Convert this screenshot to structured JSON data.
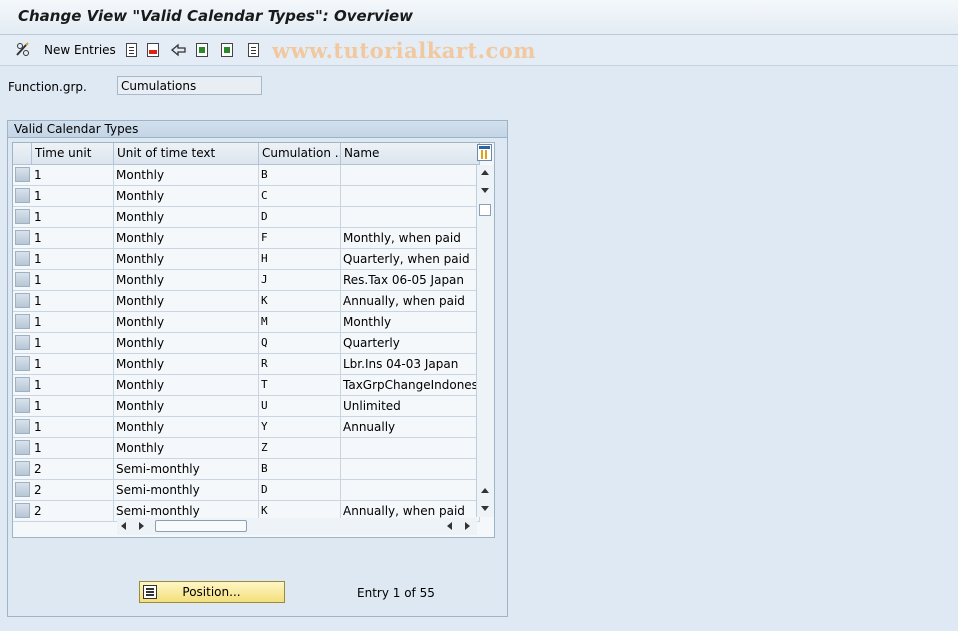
{
  "window": {
    "title": "Change View \"Valid Calendar Types\": Overview"
  },
  "toolbar": {
    "new_entries_label": "New Entries",
    "icons": [
      "pencil-glasses-icon",
      "copy-icon",
      "delete-icon",
      "undo-icon",
      "select-all-icon",
      "select-block-icon",
      "deselect-all-icon"
    ]
  },
  "watermark": "www.tutorialkart.com",
  "filter": {
    "label": "Function.grp.",
    "value": "Cumulations"
  },
  "group": {
    "title": "Valid Calendar Types",
    "columns": [
      "Time unit",
      "Unit of time text",
      "Cumulation ...",
      "Name"
    ],
    "rows": [
      [
        "1",
        "Monthly",
        "B",
        ""
      ],
      [
        "1",
        "Monthly",
        "C",
        ""
      ],
      [
        "1",
        "Monthly",
        "D",
        ""
      ],
      [
        "1",
        "Monthly",
        "F",
        "Monthly, when paid"
      ],
      [
        "1",
        "Monthly",
        "H",
        "Quarterly, when paid"
      ],
      [
        "1",
        "Monthly",
        "J",
        "Res.Tax 06-05  Japan"
      ],
      [
        "1",
        "Monthly",
        "K",
        "Annually, when paid"
      ],
      [
        "1",
        "Monthly",
        "M",
        "Monthly"
      ],
      [
        "1",
        "Monthly",
        "Q",
        "Quarterly"
      ],
      [
        "1",
        "Monthly",
        "R",
        "Lbr.Ins 04-03  Japan"
      ],
      [
        "1",
        "Monthly",
        "T",
        "TaxGrpChangeIndones."
      ],
      [
        "1",
        "Monthly",
        "U",
        "Unlimited"
      ],
      [
        "1",
        "Monthly",
        "Y",
        "Annually"
      ],
      [
        "1",
        "Monthly",
        "Z",
        ""
      ],
      [
        "2",
        "Semi-monthly",
        "B",
        ""
      ],
      [
        "2",
        "Semi-monthly",
        "D",
        ""
      ],
      [
        "2",
        "Semi-monthly",
        "K",
        "Annually, when paid"
      ]
    ]
  },
  "footer": {
    "position_label": "Position...",
    "entry_text": "Entry 1 of 55"
  }
}
